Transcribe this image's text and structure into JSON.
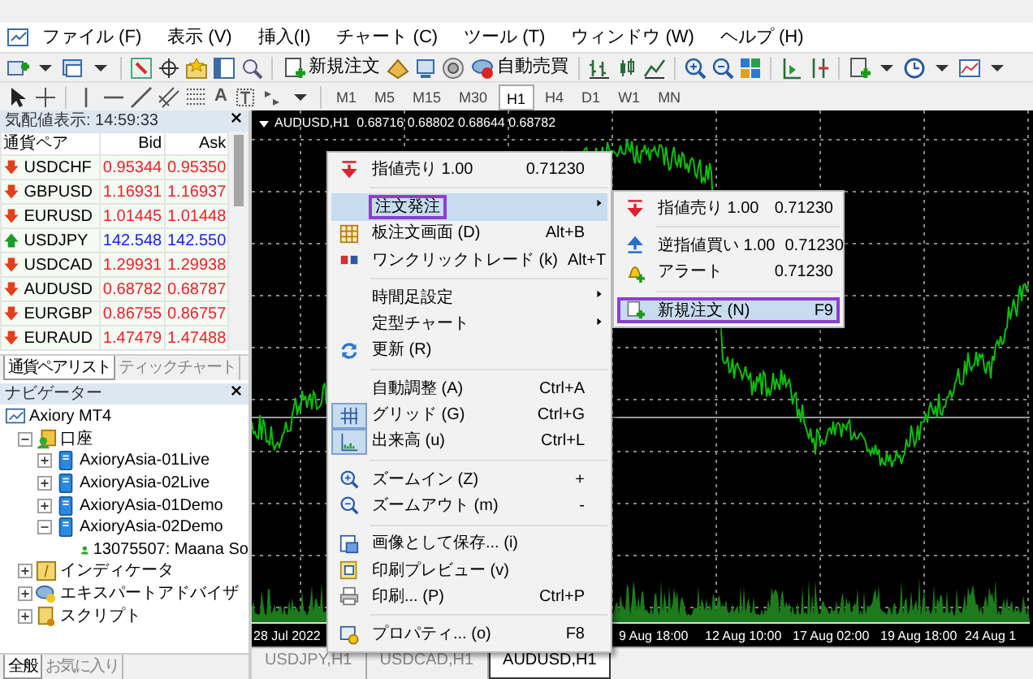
{
  "menu_bar": [
    "ファイル (F)",
    "表示 (V)",
    "挿入(I)",
    "チャート (C)",
    "ツール (T)",
    "ウィンドウ (W)",
    "ヘルプ (H)"
  ],
  "toolbar": {
    "buttons": [
      "新規注文",
      "自動売買"
    ]
  },
  "drawing_toolbar": {
    "text_tool": "A",
    "timeframes": [
      {
        "label": "M1",
        "selected": false
      },
      {
        "label": "M5",
        "selected": false
      },
      {
        "label": "M15",
        "selected": false
      },
      {
        "label": "M30",
        "selected": false
      },
      {
        "label": "H1",
        "selected": true
      },
      {
        "label": "H4",
        "selected": false
      },
      {
        "label": "D1",
        "selected": false
      },
      {
        "label": "W1",
        "selected": false
      },
      {
        "label": "MN",
        "selected": false
      }
    ]
  },
  "market_watch": {
    "title": "気配値表示: 14:59:33",
    "columns": [
      "通貨ペア",
      "Bid",
      "Ask"
    ],
    "rows": [
      {
        "symbol": "USDCHF",
        "bid": "0.95344",
        "ask": "0.95350",
        "up": false
      },
      {
        "symbol": "GBPUSD",
        "bid": "1.16931",
        "ask": "1.16937",
        "up": false
      },
      {
        "symbol": "EURUSD",
        "bid": "1.01445",
        "ask": "1.01448",
        "up": false
      },
      {
        "symbol": "USDJPY",
        "bid": "142.548",
        "ask": "142.550",
        "up": true
      },
      {
        "symbol": "USDCAD",
        "bid": "1.29931",
        "ask": "1.29938",
        "up": false
      },
      {
        "symbol": "AUDUSD",
        "bid": "0.68782",
        "ask": "0.68787",
        "up": false
      },
      {
        "symbol": "EURGBP",
        "bid": "0.86755",
        "ask": "0.86757",
        "up": false
      },
      {
        "symbol": "EURAUD",
        "bid": "1.47479",
        "ask": "1.47488",
        "up": false
      }
    ],
    "tabs": [
      {
        "label": "通貨ペアリスト",
        "selected": true
      },
      {
        "label": "ティックチャート",
        "selected": false
      }
    ]
  },
  "navigator": {
    "title": "ナビゲーター",
    "tree": [
      {
        "label": "Axiory MT4",
        "children": [
          {
            "label": "口座",
            "expanded": true,
            "children": [
              {
                "label": "AxioryAsia-01Live",
                "expanded": false
              },
              {
                "label": "AxioryAsia-02Live",
                "expanded": false
              },
              {
                "label": "AxioryAsia-01Demo",
                "expanded": false
              },
              {
                "label": "AxioryAsia-02Demo",
                "expanded": true,
                "children": [
                  {
                    "label": "13075507: Maana So"
                  }
                ]
              }
            ]
          },
          {
            "label": "インディケータ",
            "expanded": false
          },
          {
            "label": "エキスパートアドバイザ",
            "expanded": false
          },
          {
            "label": "スクリプト",
            "expanded": false
          }
        ]
      }
    ],
    "tabs": [
      {
        "label": "全般",
        "selected": true
      },
      {
        "label": "お気に入り",
        "selected": false
      }
    ]
  },
  "chart": {
    "header": "AUDUSD,H1  0.68716 0.68802 0.68644 0.68782",
    "time_labels": [
      "28 Jul 2022",
      "9 Aug 18:00",
      "12 Aug 10:00",
      "17 Aug 02:00",
      "19 Aug 18:00",
      "24 Aug 1"
    ],
    "tabs": [
      {
        "label": "USDJPY,H1",
        "selected": false
      },
      {
        "label": "USDCAD,H1",
        "selected": false
      },
      {
        "label": "AUDUSD,H1",
        "selected": true
      }
    ]
  },
  "context_menu": [
    {
      "kind": "item",
      "label": "指値売り 1.00",
      "shortcut": "0.71230",
      "submenu": false,
      "selected": false,
      "checked": false,
      "outlined": false
    },
    {
      "kind": "separator"
    },
    {
      "kind": "item",
      "label": "注文発注",
      "submenu": true,
      "selected": true,
      "checked": false,
      "outlined": true
    },
    {
      "kind": "item",
      "label": "板注文画面 (D)",
      "shortcut": "Alt+B",
      "submenu": false,
      "selected": false,
      "checked": false,
      "outlined": false
    },
    {
      "kind": "item",
      "label": "ワンクリックトレード (k)",
      "shortcut": "Alt+T",
      "submenu": false,
      "selected": false,
      "checked": false,
      "outlined": false
    },
    {
      "kind": "separator"
    },
    {
      "kind": "item",
      "label": "時間足設定",
      "submenu": true,
      "selected": false,
      "checked": false,
      "outlined": false
    },
    {
      "kind": "item",
      "label": "定型チャート",
      "submenu": true,
      "selected": false,
      "checked": false,
      "outlined": false
    },
    {
      "kind": "item",
      "label": "更新 (R)",
      "submenu": false,
      "selected": false,
      "checked": false,
      "outlined": false
    },
    {
      "kind": "separator"
    },
    {
      "kind": "item",
      "label": "自動調整 (A)",
      "shortcut": "Ctrl+A",
      "submenu": false,
      "selected": false,
      "checked": false,
      "outlined": false
    },
    {
      "kind": "item",
      "label": "グリッド (G)",
      "shortcut": "Ctrl+G",
      "submenu": false,
      "selected": false,
      "checked": true,
      "outlined": false
    },
    {
      "kind": "item",
      "label": "出来高 (u)",
      "shortcut": "Ctrl+L",
      "submenu": false,
      "selected": false,
      "checked": true,
      "outlined": false
    },
    {
      "kind": "separator"
    },
    {
      "kind": "item",
      "label": "ズームイン (Z)",
      "shortcut": "+",
      "submenu": false,
      "selected": false,
      "checked": false,
      "outlined": false
    },
    {
      "kind": "item",
      "label": "ズームアウト (m)",
      "shortcut": "-",
      "submenu": false,
      "selected": false,
      "checked": false,
      "outlined": false
    },
    {
      "kind": "separator"
    },
    {
      "kind": "item",
      "label": "画像として保存... (i)",
      "submenu": false,
      "selected": false,
      "checked": false,
      "outlined": false
    },
    {
      "kind": "item",
      "label": "印刷プレビュー (v)",
      "submenu": false,
      "selected": false,
      "checked": false,
      "outlined": false
    },
    {
      "kind": "item",
      "label": "印刷... (P)",
      "shortcut": "Ctrl+P",
      "submenu": false,
      "selected": false,
      "checked": false,
      "outlined": false
    },
    {
      "kind": "separator"
    },
    {
      "kind": "item",
      "label": "プロパティ... (o)",
      "shortcut": "F8",
      "submenu": false,
      "selected": false,
      "checked": false,
      "outlined": false
    }
  ],
  "submenu": [
    {
      "kind": "item",
      "label": "指値売り 1.00",
      "shortcut": "0.71230",
      "selected": false,
      "outlined": false
    },
    {
      "kind": "separator"
    },
    {
      "kind": "item",
      "label": "逆指値買い 1.00",
      "shortcut": "0.71230",
      "selected": false,
      "outlined": false
    },
    {
      "kind": "item",
      "label": "アラート",
      "shortcut": "0.71230",
      "selected": false,
      "outlined": false
    },
    {
      "kind": "separator"
    },
    {
      "kind": "item",
      "label": "新規注文 (N)",
      "shortcut": "F9",
      "selected": true,
      "outlined": true
    }
  ]
}
